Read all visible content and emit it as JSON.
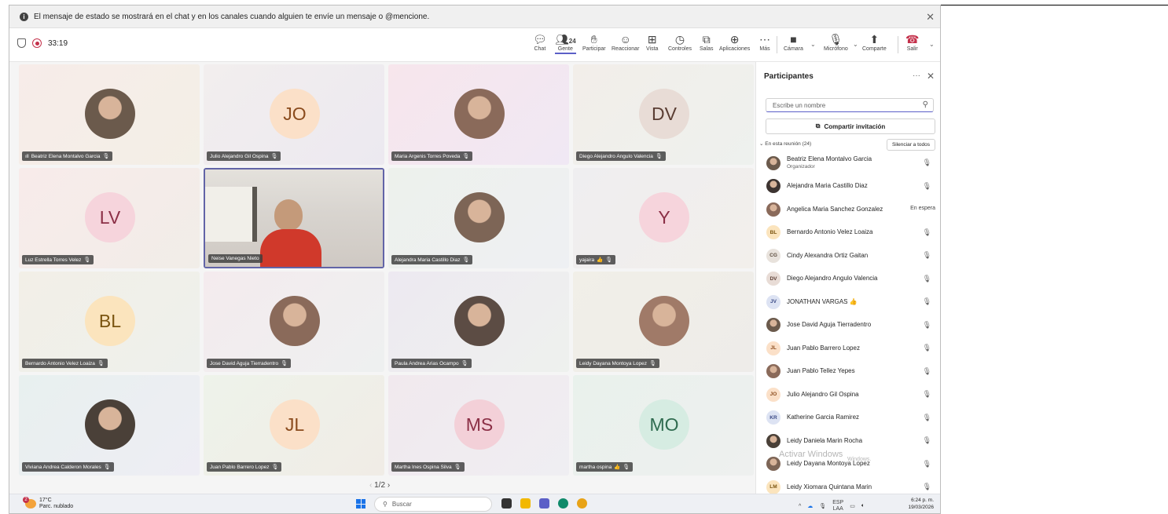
{
  "banner": {
    "text": "El mensaje de estado se mostrará en el chat y en los canales cuando alguien te envíe un mensaje o @mencione."
  },
  "meeting": {
    "timer": "33:19"
  },
  "toolbar": {
    "chat": "Chat",
    "people_count": "24",
    "people": "Gente",
    "raise": "Participar",
    "react": "Reaccionar",
    "view": "Vista",
    "controls": "Controles",
    "rooms": "Salas",
    "apps": "Aplicaciones",
    "more": "Más",
    "camera": "Cámara",
    "mic": "Micrófono",
    "share": "Comparte",
    "leave": "Salir"
  },
  "tiles": [
    {
      "name": "Beatriz Elena Montalvo Garcia",
      "initials": "",
      "photo": true,
      "prefix": "ıll"
    },
    {
      "name": "Julio Alejandro Gil Ospina",
      "initials": "JO"
    },
    {
      "name": "Maria Argenis Torres Poveda",
      "initials": "",
      "photo": true
    },
    {
      "name": "Diego Alejandro Angulo Valencia",
      "initials": "DV"
    },
    {
      "name": "Luz Estrella Torres Velez",
      "initials": "LV"
    },
    {
      "name": "Neise Vanegas Nieto",
      "initials": "",
      "video": true
    },
    {
      "name": "Alejandra Maria Castillo Diaz",
      "initials": "",
      "photo": true
    },
    {
      "name": "yajaira",
      "initials": "Y",
      "extra": "👍"
    },
    {
      "name": "Bernardo Antonio Velez Loaiza",
      "initials": "BL"
    },
    {
      "name": "Jose David Aguja Tierradentro",
      "initials": "",
      "photo": true
    },
    {
      "name": "Paula Andrea Arias Ocampo",
      "initials": "",
      "photo": true
    },
    {
      "name": "Leidy Dayana Montoya Lopez",
      "initials": "",
      "photo": true
    },
    {
      "name": "Viviana Andrea Calderon Morales",
      "initials": "",
      "photo": true
    },
    {
      "name": "Juan Pablo Barrero Lopez",
      "initials": "JL"
    },
    {
      "name": "Martha Ines Ospina Silva",
      "initials": "MS"
    },
    {
      "name": "martha ospina",
      "initials": "MO",
      "extra": "👍"
    }
  ],
  "pager": "1/2",
  "panel": {
    "title": "Participantes",
    "search_placeholder": "Escribe un nombre",
    "invite": "Compartir invitación",
    "section": "En esta reunión (24)",
    "mute_all": "Silenciar a todos",
    "participants": [
      {
        "name": "Beatriz Elena Montalvo Garcia",
        "role": "Organizador",
        "initials": "",
        "photo": true
      },
      {
        "name": "Alejandra Maria Castillo Diaz",
        "initials": "",
        "photo": true
      },
      {
        "name": "Angelica Maria Sanchez Gonzalez",
        "initials": "",
        "photo": true,
        "status": "En espera"
      },
      {
        "name": "Bernardo Antonio Velez Loaiza",
        "initials": "BL"
      },
      {
        "name": "Cindy Alexandra Ortiz Gaitan",
        "initials": "CG"
      },
      {
        "name": "Diego Alejandro Angulo Valencia",
        "initials": "DV"
      },
      {
        "name": "JONATHAN VARGAS",
        "initials": "JV",
        "extra": "👍"
      },
      {
        "name": "Jose David Aguja Tierradentro",
        "initials": "",
        "photo": true
      },
      {
        "name": "Juan Pablo Barrero Lopez",
        "initials": "JL"
      },
      {
        "name": "Juan Pablo Tellez Yepes",
        "initials": "",
        "photo": true
      },
      {
        "name": "Julio Alejandro Gil Ospina",
        "initials": "JO"
      },
      {
        "name": "Katherine Garcia Ramirez",
        "initials": "KR"
      },
      {
        "name": "Leidy Daniela Marin Rocha",
        "initials": "",
        "photo": true
      },
      {
        "name": "Leidy Dayana Montoya Lopez",
        "initials": "",
        "photo": true
      },
      {
        "name": "Leidy Xiomara Quintana Marin",
        "initials": "LM"
      }
    ],
    "watermark_title": "Activar Windows",
    "watermark_sub": "Windows."
  },
  "taskbar": {
    "temp": "17°C",
    "weather": "Parc. nublado",
    "weather_badge": "2",
    "search": "Buscar",
    "lang1": "ESP",
    "lang2": "LAA",
    "time": "6:24 p. m.",
    "date": "19/03/2026"
  },
  "colors": {
    "accent": "#5b5fc7",
    "leave": "#c4314b"
  }
}
